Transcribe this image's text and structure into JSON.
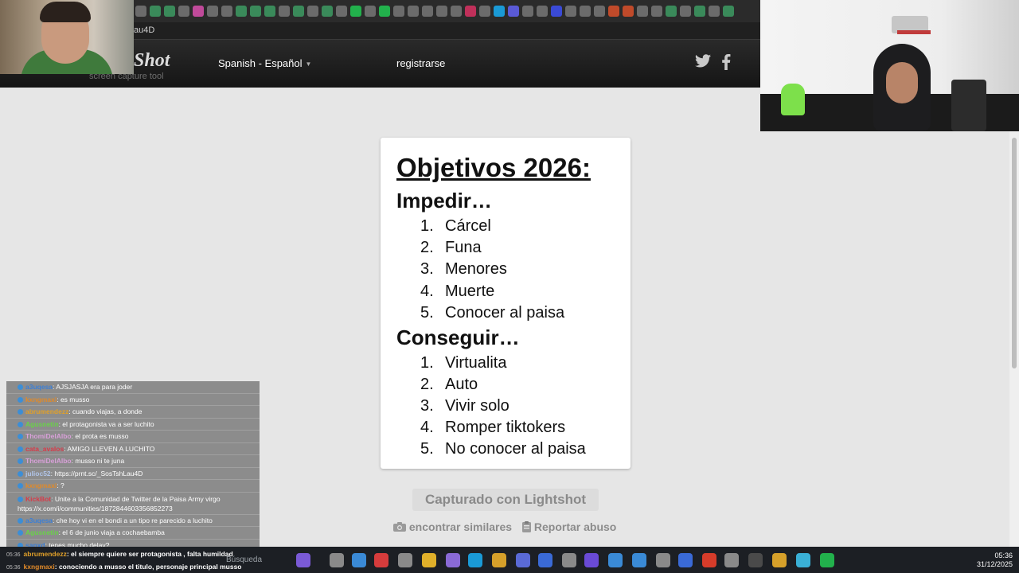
{
  "browser": {
    "url_fragment": "au4D"
  },
  "header": {
    "logo": "Shot",
    "tagline": "screen capture tool",
    "language": "Spanish - Español",
    "register": "registrarse"
  },
  "paper": {
    "title": "Objetivos 2026:",
    "section1": {
      "heading": "Impedir…",
      "items": [
        {
          "num": "1.",
          "text": "Cárcel"
        },
        {
          "num": "2.",
          "text": "Funa"
        },
        {
          "num": "3.",
          "text": "Menores"
        },
        {
          "num": "4.",
          "text": "Muerte"
        },
        {
          "num": "5.",
          "text": "Conocer al paisa"
        }
      ]
    },
    "section2": {
      "heading": "Conseguir…",
      "items": [
        {
          "num": "1.",
          "text": "Virtualita"
        },
        {
          "num": "2.",
          "text": "Auto"
        },
        {
          "num": "3.",
          "text": "Vivir solo"
        },
        {
          "num": "4.",
          "text": "Romper tiktokers"
        },
        {
          "num": "5.",
          "text": "No conocer al paisa"
        }
      ]
    }
  },
  "footer": {
    "captured": "Capturado con Lightshot",
    "similar": "encontrar similares",
    "abuse": "Reportar abuso"
  },
  "chat": {
    "lines": [
      {
        "user": "a3uqesa",
        "msg": ": AJSJASJA era para joder",
        "color": "#3c7fd6"
      },
      {
        "user": "kxngmaxi",
        "msg": ": es musso",
        "color": "#e08a2a"
      },
      {
        "user": "abrumendezz",
        "msg": ": cuando viajas, a donde",
        "color": "#e0a02a"
      },
      {
        "user": "Agusnetin",
        "msg": ": el protagonista va a ser luchito",
        "color": "#6ad14a"
      },
      {
        "user": "ThomiDelAlbo",
        "msg": ": el prota es musso",
        "color": "#d8a0d8"
      },
      {
        "user": "cata_avalos",
        "msg": ": AMIGO LLEVEN A LUCHITO",
        "color": "#d63c4a"
      },
      {
        "user": "ThomiDelAlbo",
        "msg": ": musso ni te juna",
        "color": "#d8a0d8"
      },
      {
        "user": "julioc52",
        "msg": ": https://prnt.sc/_SosTshLau4D",
        "color": "#b0c4e8"
      },
      {
        "user": "kxngmaxi",
        "msg": ": ?",
        "color": "#e08a2a"
      },
      {
        "user": "KickBot",
        "msg": ": Unite a la Comunidad de Twitter de la Paisa Army virgo https://x.com/i/communities/1872844603356852273",
        "color": "#d63c4a",
        "long": true
      },
      {
        "user": "a3uqesa",
        "msg": ": che hoy vi en el bondi a un tipo re parecido a luchito",
        "color": "#3c7fd6"
      },
      {
        "user": "Agusnetin",
        "msg": ": el 6 de junio viaja a cochaebamba",
        "color": "#6ad14a"
      },
      {
        "user": "sapxd",
        "msg": ": tenes mucho delay?",
        "color": "#3c7fd6"
      }
    ],
    "taskbar_lines": [
      {
        "time": "05:36",
        "user": "abrumendezz",
        "msg": ": el siempre quiere ser protagonista , falta humildad",
        "color": "#e0a02a"
      },
      {
        "time": "05:36",
        "user": "kxngmaxi",
        "msg": ": conociendo a musso el titulo, personaje principal musso",
        "color": "#e08a2a"
      }
    ]
  },
  "taskbar": {
    "search": "Búsqueda",
    "time": "05:36",
    "date": "31/12/2025"
  },
  "colors": {
    "header": "#1a1a1a",
    "page": "#e6e6e6",
    "paper": "#ffffff"
  }
}
